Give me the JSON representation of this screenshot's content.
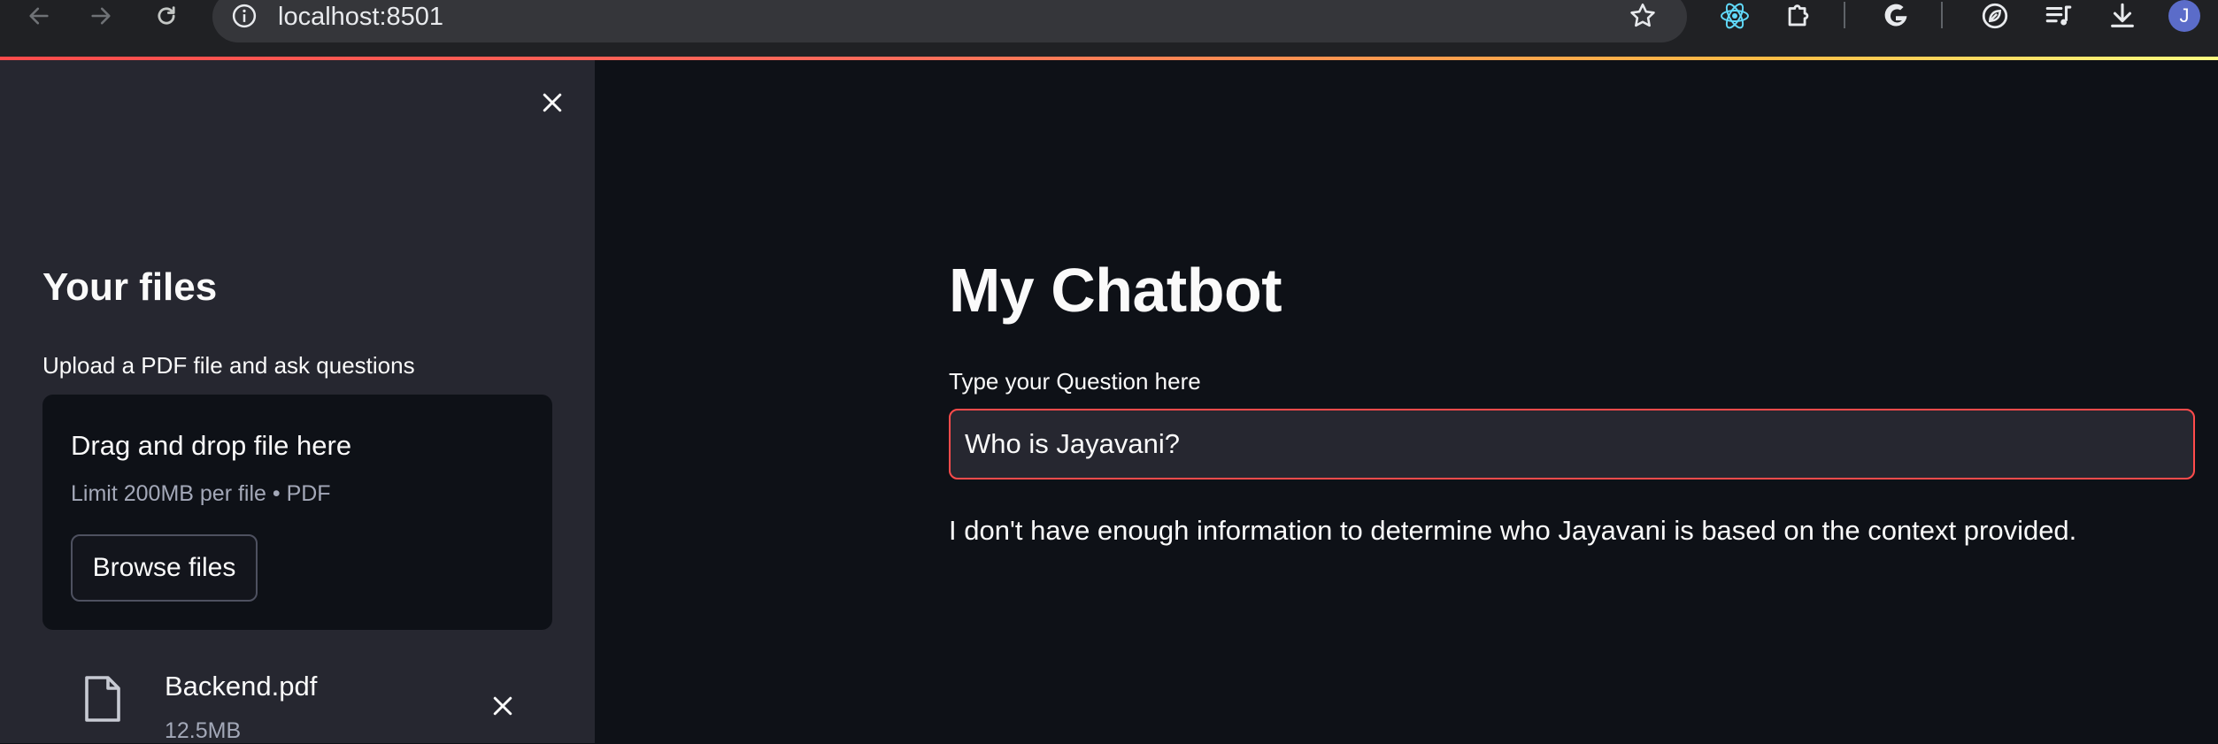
{
  "browser": {
    "url": "localhost:8501",
    "profile_initial": "J",
    "icons": [
      "back-arrow-icon",
      "forward-arrow-icon",
      "reload-icon",
      "site-info-icon",
      "bookmark-star-icon",
      "react-devtools-icon",
      "extensions-puzzle-icon",
      "google-icon",
      "leaf-icon",
      "media-control-icon",
      "download-icon"
    ]
  },
  "sidebar": {
    "title": "Your files",
    "upload_label": "Upload a PDF file and ask questions",
    "dropzone": {
      "title": "Drag and drop file here",
      "subtitle": "Limit 200MB per file • PDF",
      "browse_label": "Browse files"
    },
    "file": {
      "name": "Backend.pdf",
      "size": "12.5MB"
    }
  },
  "main": {
    "title": "My Chatbot",
    "question_label": "Type your Question here",
    "question_value": "Who is Jayavani?",
    "answer": "I don't have enough information to determine who Jayavani is based on the context provided."
  },
  "colors": {
    "accent": "#ff4b4b",
    "background": "#0e1117",
    "sidebar": "#262730",
    "text": "#fafafa",
    "muted_text": "#a3a8b8"
  }
}
